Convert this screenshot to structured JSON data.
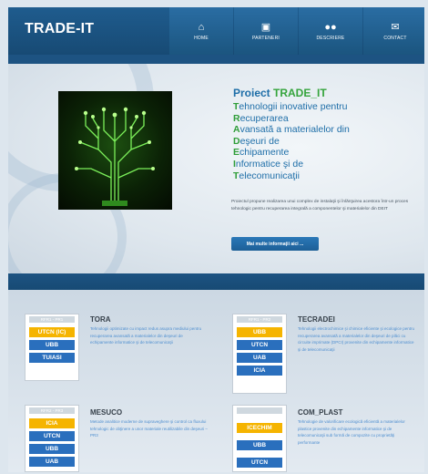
{
  "header": {
    "logo": "TRADE-IT",
    "nav": [
      {
        "label": "HOME",
        "icon": "home-icon"
      },
      {
        "label": "PARTENERI",
        "icon": "image-icon"
      },
      {
        "label": "DESCRIERE",
        "icon": "users-icon"
      },
      {
        "label": "CONTACT",
        "icon": "envelope-icon"
      }
    ]
  },
  "hero": {
    "title_prefix": "Proiect ",
    "title_accent": "TRADE_IT",
    "acronym_lines": [
      {
        "cap": "T",
        "rest": "ehnologii inovative pentru"
      },
      {
        "cap": "R",
        "rest": "ecuperarea"
      },
      {
        "cap": "A",
        "rest": "vansată a materialelor din"
      },
      {
        "cap": "D",
        "rest": "eşeuri de"
      },
      {
        "cap": "E",
        "rest": "chipamente"
      },
      {
        "cap": "I",
        "rest": "nformatice şi de"
      },
      {
        "cap": "T",
        "rest": "elecomunicaţii"
      }
    ],
    "description": "Proiectul propune realizarea unui complex de instalaţii şi înlănţuirea acestora într-un proces tehnologic pentru recuperarea integrală a componentelor şi materialelor din DEIT",
    "button_label": "Mai multe informaţii aici ..."
  },
  "projects": [
    {
      "header": "RFR1 - PR1",
      "partners": [
        {
          "name": "UTCN (IC)",
          "color": "yellow"
        },
        {
          "name": "UBB",
          "color": "blue"
        },
        {
          "name": "TUIASI",
          "color": "blue"
        }
      ],
      "title": "TORA",
      "description": "Tehnologii optimizate cu impact redus asupra mediului pentru recuperarea avansată a materialelor din deşeuri de echipamente informatice şi de telecomunicaţii"
    },
    {
      "header": "RFR1 - PR2",
      "partners": [
        {
          "name": "UBB",
          "color": "yellow"
        },
        {
          "name": "UTCN",
          "color": "blue"
        },
        {
          "name": "UAB",
          "color": "blue"
        },
        {
          "name": "ICIA",
          "color": "blue"
        }
      ],
      "title": "TECRADEI",
      "description": "Tehnologii electrochimice şi chimice eficiente şi ecologice pentru recuperarea avansată a materialelor din deşeuri de plăci cu circuite imprimate (DPCI) provenite din echipamente informatice şi de telecomunicaţii"
    },
    {
      "header": "RFR2 - PR3",
      "partners": [
        {
          "name": "ICIA",
          "color": "yellow"
        },
        {
          "name": "UTCN",
          "color": "blue"
        },
        {
          "name": "UBB",
          "color": "blue"
        },
        {
          "name": "UAB",
          "color": "blue"
        }
      ],
      "title": "MESUCO",
      "description": "Metode analitice moderne de supraveghere şi control ca fluxului tehnologic de obţinere a unor materiale reutilizabile din deşeuri – PR3"
    },
    {
      "header": "",
      "partners": [
        {
          "name": "ICECHIM",
          "color": "yellow"
        },
        {
          "name": "UBB",
          "color": "blue"
        },
        {
          "name": "UTCN",
          "color": "blue"
        }
      ],
      "title": "COM_PLAST",
      "description": "Tehnologie de valorificare ecologică eficientă a materialelor plastice provenite din echipamente informatice şi de telecomunicaţii sub formă de compozite cu proprietăţi performante"
    }
  ],
  "colors": {
    "header": "#1f5c8e",
    "title_blue": "#1e6ea8",
    "accent_green": "#2e9d38",
    "tag_yellow": "#f5b400",
    "tag_blue": "#2a6fbd",
    "desc_blue": "#4f8fd0"
  }
}
